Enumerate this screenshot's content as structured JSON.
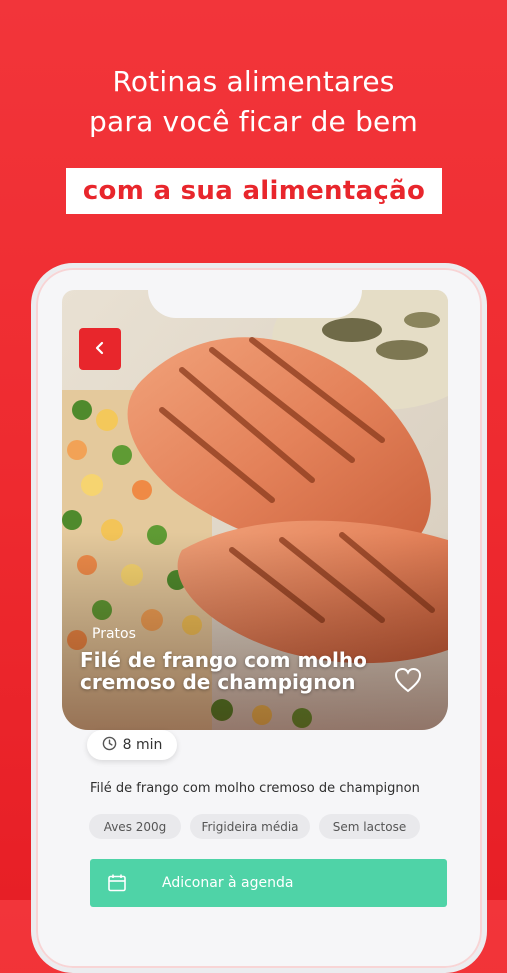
{
  "headline": {
    "line1": "Rotinas alimentares",
    "line2": "para você ficar de bem",
    "highlight": "com a sua alimentação"
  },
  "recipe": {
    "category": "Pratos",
    "title_line1": "Filé de frango com molho",
    "title_line2": "cremoso de champignon",
    "time": "8 min",
    "description": "Filé de frango com molho cremoso de champignon",
    "tags": [
      "Aves 200g",
      "Frigideira média",
      "Sem lactose"
    ]
  },
  "actions": {
    "add_to_agenda": "Adiconar à agenda"
  },
  "icons": {
    "back": "chevron-left-icon",
    "favorite": "heart-icon",
    "time": "clock-icon",
    "calendar": "calendar-icon"
  },
  "colors": {
    "brand_red": "#e8262c",
    "cta_green": "#4fd3a7"
  }
}
